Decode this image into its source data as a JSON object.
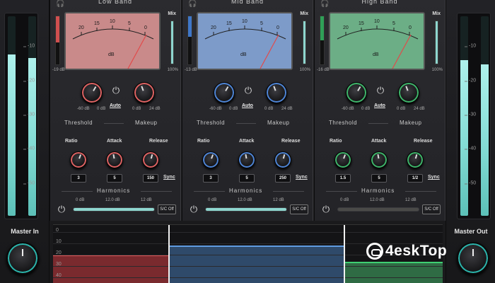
{
  "master_in": {
    "label": "Master In",
    "scale": [
      "-10",
      "-20",
      "-30",
      "-40",
      "-50"
    ],
    "levels": [
      0.81,
      0.79
    ]
  },
  "master_out": {
    "label": "Master Out",
    "scale": [
      "-10",
      "-20",
      "-30",
      "-40",
      "-50"
    ],
    "levels": [
      0.78,
      0.76
    ]
  },
  "bands": [
    {
      "title": "Low Band",
      "accent": "#e06363",
      "vu_bg": "#c98a8a",
      "gr_value": "-19 dB",
      "gr_fill_color": "#d04f4f",
      "gr_fraction": 0.55,
      "vu_ticks": [
        "20",
        "15",
        "10",
        "5",
        "0"
      ],
      "vu_unit": "dB",
      "mix_label": "Mix",
      "mix_value": "100%",
      "mix_fill_color": "#8ed6cf",
      "threshold_range": [
        "-60 dB",
        "0 dB"
      ],
      "auto_label": "Auto",
      "makeup_range": [
        "0 dB",
        "24 dB"
      ],
      "threshold_label": "Threshold",
      "makeup_label": "Makeup",
      "ratio_label": "Ratio",
      "attack_label": "Attack",
      "release_label": "Release",
      "ratio_value": "3",
      "attack_value": "5",
      "release_value": "150",
      "sync_label": "Sync",
      "harmonics_label": "Harmonics",
      "harm_range": [
        "0 dB",
        "12.0 dB",
        "12 dB"
      ],
      "harm_fill_color": "#8ed6cf",
      "sc_label": "S/C Off"
    },
    {
      "title": "Mid Band",
      "accent": "#4f86d8",
      "vu_bg": "#7d9bc9",
      "gr_value": "-13 dB",
      "gr_fill_color": "#3f77c8",
      "gr_fraction": 0.42,
      "vu_ticks": [
        "20",
        "15",
        "10",
        "5",
        "0"
      ],
      "vu_unit": "dB",
      "mix_label": "Mix",
      "mix_value": "100%",
      "mix_fill_color": "#8ed6cf",
      "threshold_range": [
        "-60 dB",
        "0 dB"
      ],
      "auto_label": "Auto",
      "makeup_range": [
        "0 dB",
        "24 dB"
      ],
      "threshold_label": "Threshold",
      "makeup_label": "Makeup",
      "ratio_label": "Ratio",
      "attack_label": "Attack",
      "release_label": "Release",
      "ratio_value": "3",
      "attack_value": "5",
      "release_value": "250",
      "sync_label": "Sync",
      "harmonics_label": "Harmonics",
      "harm_range": [
        "0 dB",
        "12.0 dB",
        "12 dB"
      ],
      "harm_fill_color": "#8ed6cf",
      "sc_label": "S/C Off"
    },
    {
      "title": "High Band",
      "accent": "#3fb76b",
      "vu_bg": "#6cae86",
      "gr_value": "-16 dB",
      "gr_fill_color": "#2f9f57",
      "gr_fraction": 0.5,
      "vu_ticks": [
        "20",
        "15",
        "10",
        "5",
        "0"
      ],
      "vu_unit": "dB",
      "mix_label": "Mix",
      "mix_value": "100%",
      "mix_fill_color": "#8ed6cf",
      "threshold_range": [
        "-60 dB",
        "0 dB"
      ],
      "auto_label": "Auto",
      "makeup_range": [
        "0 dB",
        "24 dB"
      ],
      "threshold_label": "Threshold",
      "makeup_label": "Makeup",
      "ratio_label": "Ratio",
      "attack_label": "Attack",
      "release_label": "Release",
      "ratio_value": "1.5",
      "attack_value": "5",
      "release_value": "1/2",
      "sync_label": "Sync",
      "harmonics_label": "Harmonics",
      "harm_range": [
        "0 dB",
        "12.0 dB",
        "12 dB"
      ],
      "harm_fill_color": "#4a4a48",
      "sc_label": "S/C Off"
    }
  ],
  "spectrum": {
    "scale": [
      "0",
      "10",
      "20",
      "30",
      "40"
    ],
    "band_colors": [
      "#7a2a2e",
      "#2f4a6a",
      "#2f6b44"
    ],
    "band_line_colors": [
      "#e05a5a",
      "#5f9be0",
      "#3fcf72"
    ]
  },
  "watermark": "4eskTop"
}
